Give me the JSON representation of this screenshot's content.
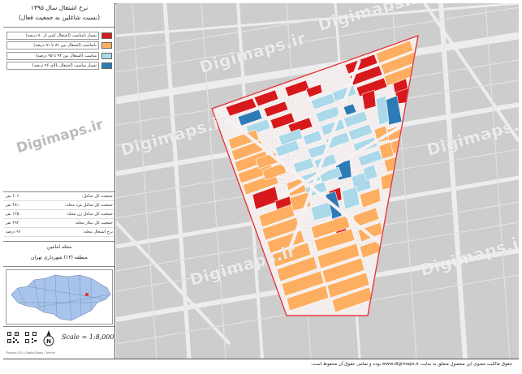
{
  "title": {
    "line1": "نرخ اشتغال سال ۱۳۹۵",
    "line2": "(نسبت شاغلین به جمعیت فعال)"
  },
  "legend": [
    {
      "label": "بسیار نامناسب (اشتغال کمتر از ۸۰ درصد)",
      "color": "#d7191c"
    },
    {
      "label": "نامناسب (اشتغال بین ۸۱ تا ۹۱ درصد)",
      "color": "#fdae61"
    },
    {
      "label": "مناسب (اشتغال بین ۹۲ تا ۹۵ درصد)",
      "color": "#abd9e9"
    },
    {
      "label": "بسیار مناسب (اشتغال بالای ۹۶ درصد)",
      "color": "#2c7bb6"
    }
  ],
  "stats": [
    {
      "label": "جمعیت کل شاغل:",
      "value": "۶۰۶۰ نفر"
    },
    {
      "label": "جمعیت کل شاغل مرد محله:",
      "value": "۴۸۱۰ نفر"
    },
    {
      "label": "جمعیت کل شاغل زن محله:",
      "value": "۱۲۵۰ نفر"
    },
    {
      "label": "جمعیت کل بیکار محله:",
      "value": "۲۹۲ نفر"
    },
    {
      "label": "نرخ اشتغال محله:",
      "value": "۹۶ درصد"
    }
  ],
  "region": {
    "name": "محله امامین",
    "district": "منطقه (۱۴) شهرداری تهران"
  },
  "scale": "Scale = 1:8,000",
  "north_label": "N",
  "watermark": "Digimaps.ir",
  "small_credit": "Persian GIS | Digital Maps | Tehran",
  "footer": "حقوق مالکیت معنوی این محصول متعلق به سایت www.digimaps.ir بوده و تمامی حقوق آن محفوظ است.",
  "colors": {
    "very_poor": "#d7191c",
    "poor": "#fdae61",
    "good": "#abd9e9",
    "very_good": "#2c7bb6",
    "boundary": "#e8353a",
    "roads": "#ececec",
    "background": "#cfcfcf",
    "inset_district": "#a9c4ea",
    "inset_highlight": "#e8353a"
  }
}
